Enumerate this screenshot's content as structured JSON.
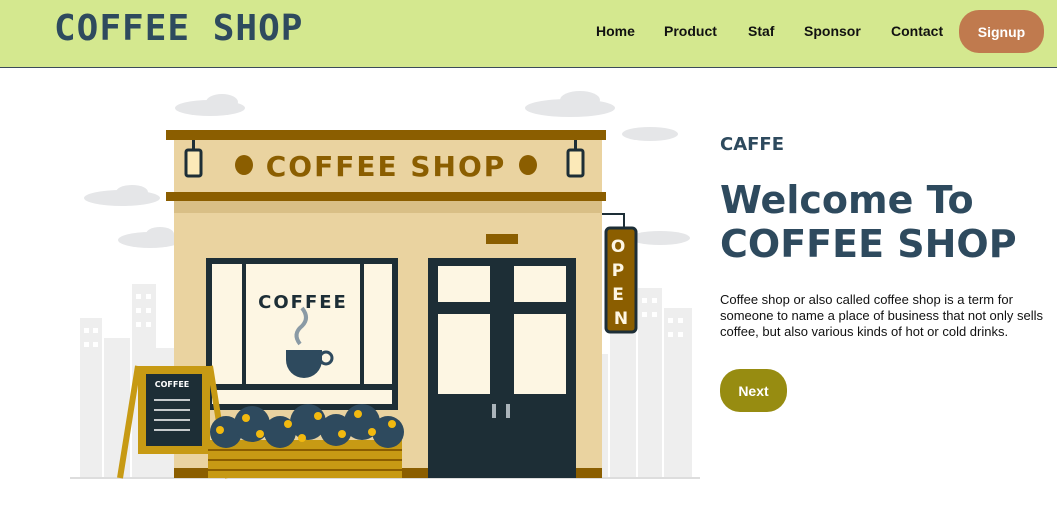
{
  "brand": {
    "logo_text": "COFFEE SHOP"
  },
  "nav": {
    "items": [
      {
        "label": "Home"
      },
      {
        "label": "Product"
      },
      {
        "label": "Staf"
      },
      {
        "label": "Sponsor"
      },
      {
        "label": "Contact"
      }
    ],
    "signup_label": "Signup"
  },
  "illustration": {
    "sign_text": "COFFEE SHOP",
    "window_text": "COFFEE",
    "board_text": "COFFEE",
    "open_sign_text": "OPEN"
  },
  "hero": {
    "eyebrow": "CAFFE",
    "title_line1": "Welcome To",
    "title_line2": "COFFEE SHOP",
    "description": "Coffee shop or also called coffee shop is a term for someone to name a place of business that not only sells coffee, but also various kinds of hot or cold drinks.",
    "next_label": "Next"
  },
  "colors": {
    "navbar_bg": "#d4e88f",
    "heading": "#2e4a5e",
    "signup_bg": "#c07a4e",
    "next_bg": "#978c11",
    "shop_wall": "#ead3a0",
    "shop_trim": "#8b5e00",
    "door": "#1d2e36"
  }
}
